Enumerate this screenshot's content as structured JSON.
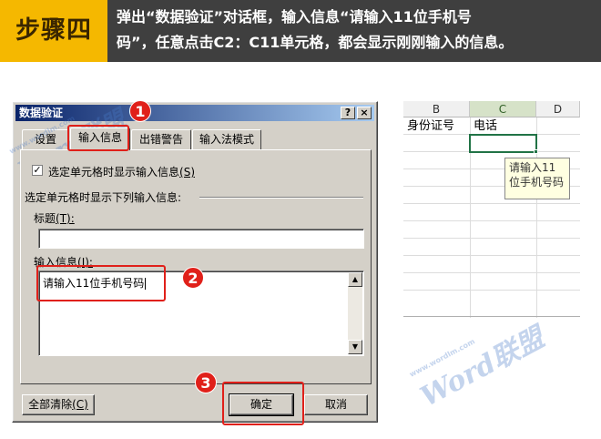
{
  "banner": {
    "step": "步骤四",
    "line1": "弹出“数据验证”对话框，输入信息“请输入11位手机号",
    "line2": "码”，任意点击C2：C11单元格，都会显示刚刚输入的信息。",
    "bg_color": "#3f3f3f",
    "accent_color": "#f5b800"
  },
  "watermark": {
    "text": "Word联盟",
    "sub": "www.wordlm.com"
  },
  "dialog": {
    "title": "数据验证",
    "help_label": "?",
    "close_label": "×",
    "tabs": [
      "设置",
      "输入信息",
      "出错警告",
      "输入法模式"
    ],
    "active_tab": 1,
    "checkbox_checked_mark": "✓",
    "checkbox_label": "选定单元格时显示输入信息",
    "checkbox_hotkey": "(S)",
    "group_label": "选定单元格时显示下列输入信息:",
    "title_field_label": "标题",
    "title_field_hotkey": "(T):",
    "title_value": "",
    "message_field_label": "输入信息",
    "message_field_hotkey": "(I):",
    "message_value": "请输入11位手机号码",
    "scroll_up": "▲",
    "scroll_down": "▼",
    "clear_all_label": "全部清除",
    "clear_all_hotkey": "(C)",
    "ok_label": "确定",
    "cancel_label": "取消"
  },
  "callouts": [
    "1",
    "2",
    "3"
  ],
  "callout_color": "#e0201a",
  "sheet": {
    "columns": [
      "B",
      "C",
      "D"
    ],
    "selected_column": "C",
    "cells": {
      "B1": "身份证号",
      "C1": "电话"
    },
    "tooltip": "请输入11位手机号码"
  }
}
